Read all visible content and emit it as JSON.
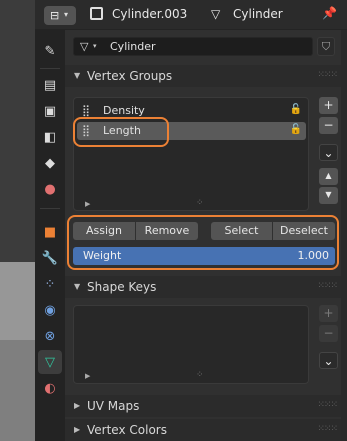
{
  "header": {
    "editor_glyph": "⊟",
    "object_name": "Cylinder.003",
    "data_name": "Cylinder",
    "data_icon": "mesh-data-icon",
    "pin_icon": "pin-icon"
  },
  "tabs": [
    {
      "name": "tab-tool",
      "glyph": "✎"
    },
    {
      "name": "tab-render",
      "glyph": "▤"
    },
    {
      "name": "tab-output",
      "glyph": "▣"
    },
    {
      "name": "tab-view-layer",
      "glyph": "◧"
    },
    {
      "name": "tab-scene",
      "glyph": "◆"
    },
    {
      "name": "tab-world",
      "glyph": "●"
    },
    {
      "name": "tab-object",
      "glyph": "■"
    },
    {
      "name": "tab-modifiers",
      "glyph": "🔧"
    },
    {
      "name": "tab-particles",
      "glyph": "⁘"
    },
    {
      "name": "tab-physics",
      "glyph": "◉"
    },
    {
      "name": "tab-constraints",
      "glyph": "⊗"
    },
    {
      "name": "tab-data",
      "glyph": "▽"
    },
    {
      "name": "tab-material",
      "glyph": "◐"
    }
  ],
  "mesh": {
    "name": "Cylinder"
  },
  "vertex_groups": {
    "title": "Vertex Groups",
    "items": [
      {
        "label": "Density",
        "selected": false
      },
      {
        "label": "Length",
        "selected": true
      }
    ],
    "buttons": {
      "assign": "Assign",
      "remove": "Remove",
      "select": "Select",
      "deselect": "Deselect"
    },
    "weight": {
      "label": "Weight",
      "value": "1.000"
    }
  },
  "shape_keys": {
    "title": "Shape Keys"
  },
  "uv_maps": {
    "title": "UV Maps"
  },
  "vertex_colors": {
    "title": "Vertex Colors"
  },
  "colors": {
    "accent": "#4772b3",
    "highlight": "#ec8135",
    "selected_row": "#5a5a5a",
    "active_tab_icon": "#31c9a0"
  },
  "side_glyphs": {
    "plus": "+",
    "minus": "−",
    "menu": "⌄",
    "up": "▲",
    "down": "▼"
  }
}
